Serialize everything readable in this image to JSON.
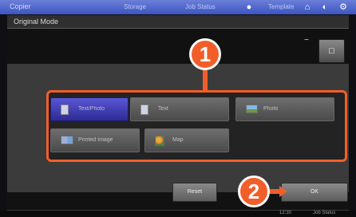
{
  "topbar": {
    "app_label": "Copier",
    "tabs": [
      "Storage",
      "Job Status",
      "Template"
    ],
    "icons": [
      "gear-icon",
      "home-icon",
      "user-icon"
    ]
  },
  "dialog": {
    "title": "Original Mode",
    "minus": "−",
    "page_button_label": "□"
  },
  "modes": [
    {
      "label": "Text/Photo",
      "icon": "text-photo-icon",
      "selected": true
    },
    {
      "label": "Text",
      "icon": "text-icon",
      "selected": false
    },
    {
      "label": "Photo",
      "icon": "photo-icon",
      "selected": false
    },
    {
      "label": "Printed Image",
      "icon": "printed-image-icon",
      "selected": false
    },
    {
      "label": "Map",
      "icon": "map-icon",
      "selected": false
    }
  ],
  "actions": {
    "reset_label": "Reset",
    "ok_label": "OK"
  },
  "callouts": {
    "one": "1",
    "two": "2"
  },
  "status": {
    "time": "12:30",
    "job": "Job Status"
  },
  "colors": {
    "accent": "#f25e2a",
    "selected": "#3d3ab2",
    "topbar": "#4a63cc"
  }
}
